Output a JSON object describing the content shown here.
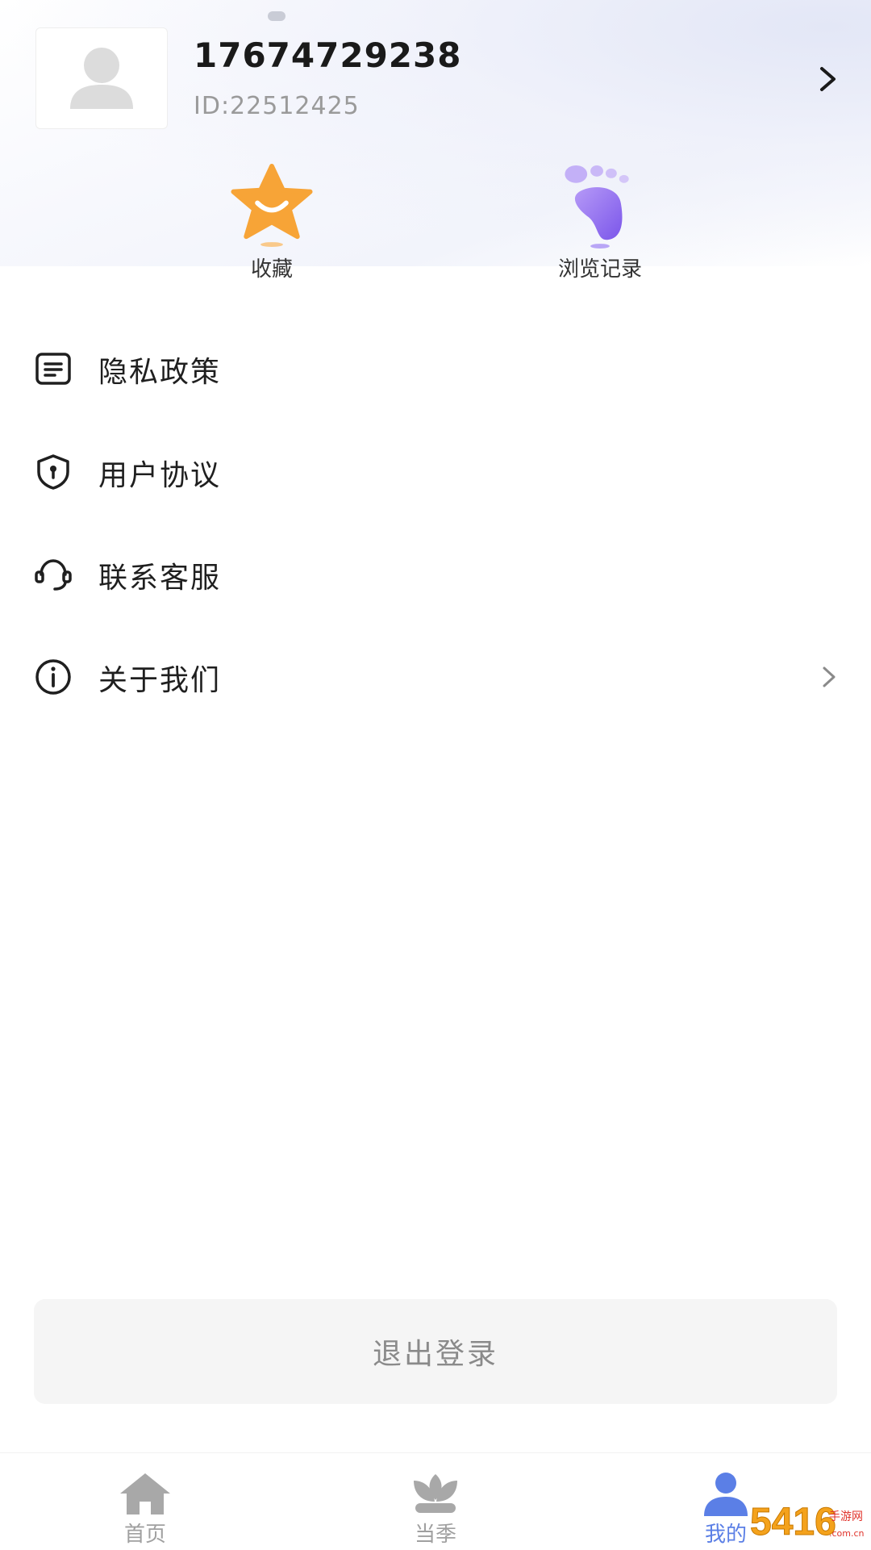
{
  "profile": {
    "phone": "17674729238",
    "user_id": "ID:22512425"
  },
  "shortcuts": [
    {
      "label": "收藏",
      "icon": "star-icon"
    },
    {
      "label": "浏览记录",
      "icon": "footprint-icon"
    }
  ],
  "menu": [
    {
      "label": "隐私政策",
      "icon": "document-icon"
    },
    {
      "label": "用户协议",
      "icon": "shield-lock-icon"
    },
    {
      "label": "联系客服",
      "icon": "headset-icon"
    },
    {
      "label": "关于我们",
      "icon": "info-icon"
    }
  ],
  "logout": {
    "label": "退出登录"
  },
  "bottom_nav": [
    {
      "label": "首页",
      "icon": "home-icon"
    },
    {
      "label": "当季",
      "icon": "lotus-icon"
    },
    {
      "label": "我的",
      "icon": "user-icon",
      "active": true
    }
  ],
  "watermark": {
    "text": "5416",
    "subtext": "手游网"
  },
  "colors": {
    "accent": "#5b7fe6",
    "star_orange": "#f7a437",
    "footprint_purple": "#8f6cf0",
    "muted_text": "#9a9a9a"
  }
}
